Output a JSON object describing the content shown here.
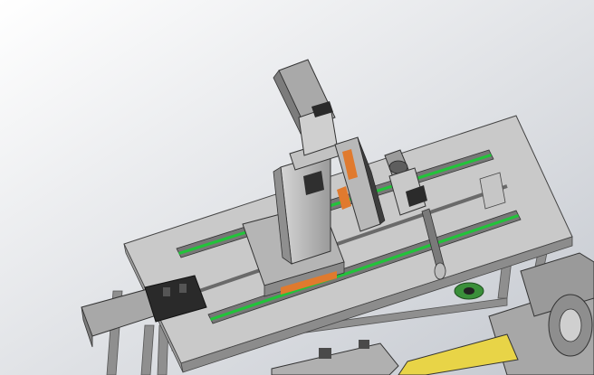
{
  "viewport": {
    "background_gradient": [
      "#ffffff",
      "#c4c8cf"
    ]
  },
  "colors": {
    "table_top": "#c7c7c7",
    "table_side": "#8b8b8b",
    "frame": "#9a9a9a",
    "rail": "#7c7c7c",
    "rail_accent": "#22c33a",
    "carriage_accent": "#e07a2e",
    "module_gray": "#a6a6a6",
    "dark_part": "#2f2f2f",
    "yellow_part": "#e8d447",
    "green_part": "#3a8f3a"
  }
}
